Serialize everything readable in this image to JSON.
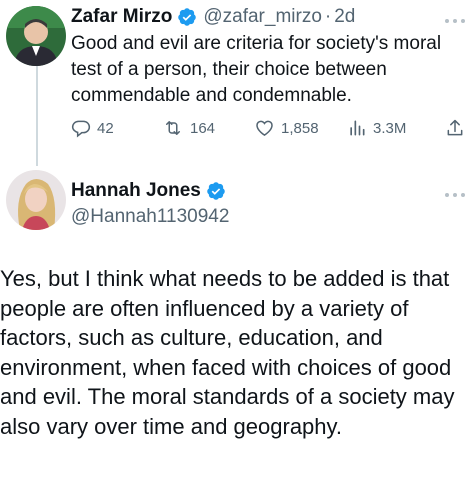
{
  "tweet": {
    "author": {
      "display_name": "Zafar Mirzo",
      "handle": "@zafar_mirzo",
      "verified": true,
      "avatar_icon": "avatar-man-icon"
    },
    "time_separator": "·",
    "time": "2d",
    "text": "Good and evil are criteria for society's moral test of a person, their choice between commendable and condemnable.",
    "stats": {
      "replies": "42",
      "retweets": "164",
      "likes": "1,858",
      "views": "3.3M"
    }
  },
  "reply": {
    "author": {
      "display_name": "Hannah Jones",
      "handle": "@Hannah1130942",
      "verified": true,
      "avatar_icon": "avatar-woman-icon"
    },
    "text": "Yes, but I think what needs to be added is that people are often influenced by a variety of factors, such as culture, education, and environment, when faced with choices of good and evil. The moral standards of a society may also vary over time and geography."
  },
  "colors": {
    "text_primary": "#0f1419",
    "text_secondary": "#536471",
    "verified_blue": "#1d9bf0",
    "thread_line": "#cfd9de"
  }
}
